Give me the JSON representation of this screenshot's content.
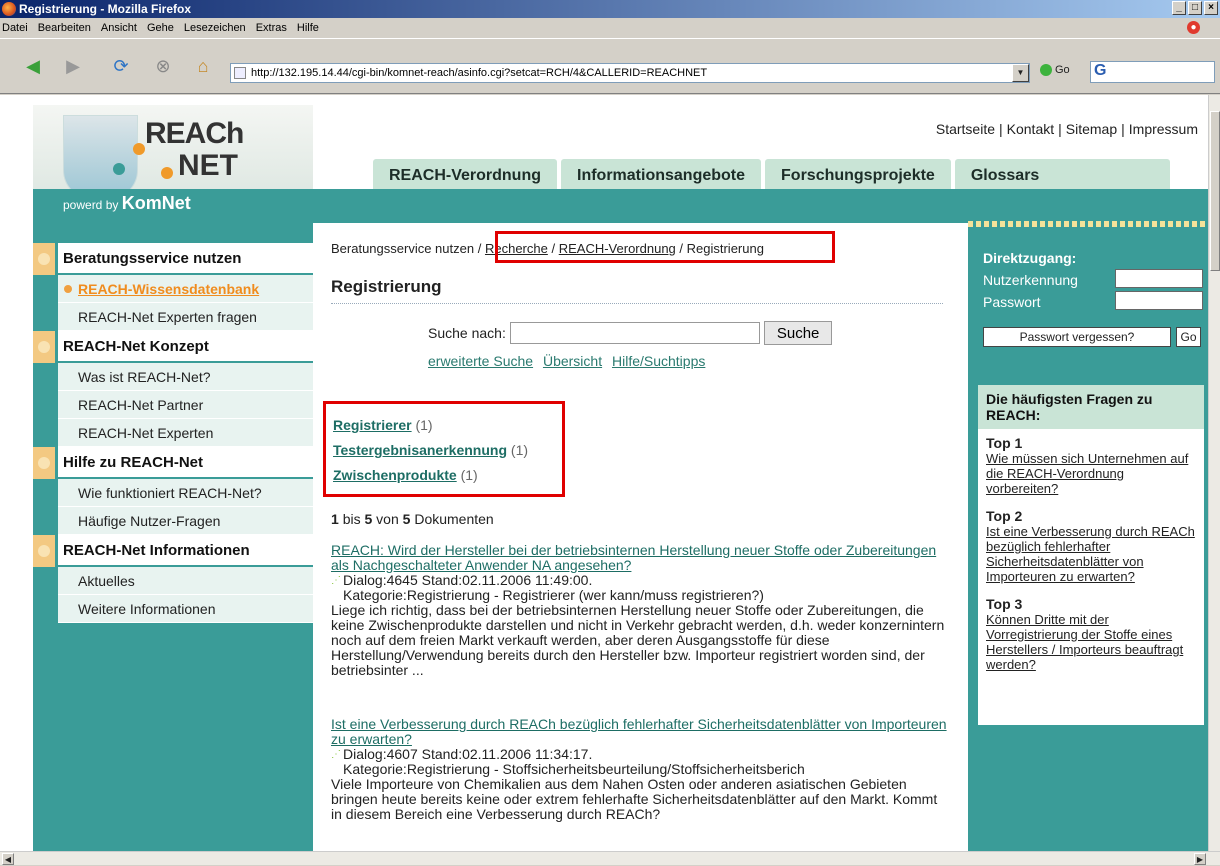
{
  "window": {
    "title": "Registrierung - Mozilla Firefox"
  },
  "menu": [
    "Datei",
    "Bearbeiten",
    "Ansicht",
    "Gehe",
    "Lesezeichen",
    "Extras",
    "Hilfe"
  ],
  "nav": {
    "url": "http://132.195.14.44/cgi-bin/komnet-reach/asinfo.cgi?setcat=RCH/4&CALLERID=REACHNET",
    "go": "Go",
    "search_logo": "G"
  },
  "logo": {
    "line1": "REACh",
    "line2": "NET",
    "powered_prefix": "powerd by",
    "powered_brand": "KomNet"
  },
  "toplinks": [
    "Startseite",
    "Kontakt",
    "Sitemap",
    "Impressum"
  ],
  "tabs": [
    "REACH-Verordnung",
    "Informationsangebote",
    "Forschungsprojekte",
    "Glossars"
  ],
  "sidebar": {
    "groups": [
      {
        "title": "Beratungsservice nutzen",
        "items": [
          "REACH-Wissensdatenbank",
          "REACH-Net Experten fragen"
        ]
      },
      {
        "title": "REACH-Net Konzept",
        "items": [
          "Was ist REACH-Net?",
          "REACH-Net Partner",
          "REACH-Net Experten"
        ]
      },
      {
        "title": "Hilfe zu REACH-Net",
        "items": [
          "Wie funktioniert REACH-Net?",
          "Häufige Nutzer-Fragen"
        ]
      },
      {
        "title": "REACH-Net Informationen",
        "items": [
          "Aktuelles",
          "Weitere Informationen"
        ]
      }
    ]
  },
  "breadcrumb": {
    "first": "Beratungsservice nutzen",
    "sep": "/",
    "recherche": "Recherche",
    "verordnung": "REACH-Verordnung",
    "current": "/ Registrierung"
  },
  "main": {
    "title": "Registrierung",
    "search_label": "Suche nach:",
    "search_button": "Suche",
    "links": [
      "erweiterte Suche",
      "Übersicht",
      "Hilfe/Suchtipps"
    ],
    "categories": [
      {
        "name": "Registrierer",
        "count": "(1)"
      },
      {
        "name": "Testergebnisanerkennung",
        "count": "(1)"
      },
      {
        "name": "Zwischenprodukte",
        "count": "(1)"
      }
    ],
    "count": {
      "from": "1",
      "bis": "bis",
      "to": "5",
      "von": "von",
      "total": "5",
      "suffix": "Dokumenten"
    },
    "results": [
      {
        "title": "REACH: Wird der Hersteller bei der betriebsinternen Herstellung neuer Stoffe oder Zubereitungen als Nachgeschalteter Anwender NA angesehen?",
        "meta1": "Dialog:4645 Stand:02.11.2006 11:49:00.",
        "meta2": "Kategorie:Registrierung - Registrierer (wer kann/muss registrieren?)",
        "body": "Liege ich richtig, dass bei der betriebsinternen Herstellung neuer Stoffe oder Zubereitungen, die keine Zwischenprodukte darstellen und nicht in Verkehr gebracht werden, d.h. weder konzernintern noch auf dem freien Markt verkauft werden, aber deren Ausgangsstoffe für diese Herstellung/Verwendung bereits durch den Hersteller bzw. Importeur registriert worden sind, der betriebsinter ..."
      },
      {
        "title": "Ist eine Verbesserung durch REACh bezüglich fehlerhafter Sicherheitsdatenblätter von Importeuren zu erwarten?",
        "meta1": "Dialog:4607 Stand:02.11.2006 11:34:17.",
        "meta2": "Kategorie:Registrierung - Stoffsicherheitsbeurteilung/Stoffsicherheitsberich",
        "body": "Viele Importeure von Chemikalien aus dem Nahen Osten oder anderen asiatischen Gebieten bringen heute bereits keine oder extrem fehlerhafte Sicherheitsdatenblätter auf den Markt. Kommt in diesem Bereich eine Verbesserung durch REACh?"
      }
    ]
  },
  "direct": {
    "title": "Direktzugang:",
    "user": "Nutzerkennung",
    "pass": "Passwort",
    "forgot": "Passwort vergessen?",
    "go": "Go"
  },
  "faq": {
    "title": "Die häufigsten Fragen zu REACH:",
    "items": [
      {
        "label": "Top 1",
        "text": "Wie müssen sich Unternehmen auf die REACH-Verordnung vorbereiten?"
      },
      {
        "label": "Top 2",
        "text": "Ist eine Verbesserung durch REACh bezüglich fehlerhafter Sicherheitsdatenblätter von Importeuren zu erwarten?"
      },
      {
        "label": "Top 3",
        "text": "Können Dritte mit der Vorregistrierung der Stoffe eines Herstellers / Importeurs beauftragt werden?"
      }
    ]
  },
  "colors": {
    "teal": "#3a9c98",
    "tab": "#c9e4d6",
    "orange": "#f08c1e",
    "highlight": "#e00000"
  }
}
